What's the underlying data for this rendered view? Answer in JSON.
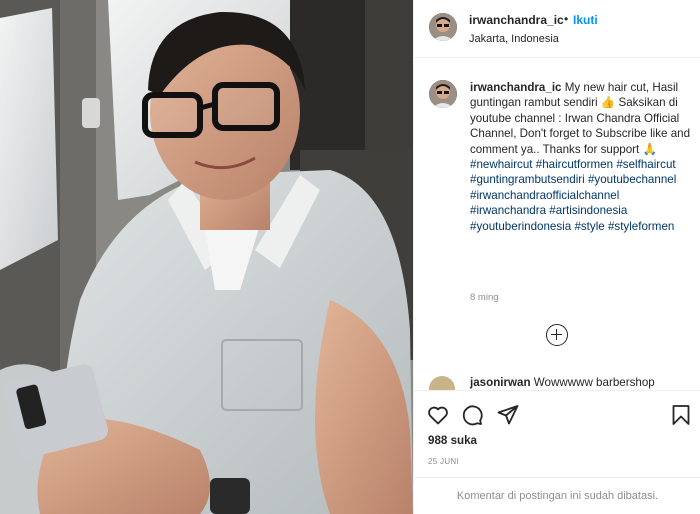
{
  "post": {
    "username": "irwanchandra_ic",
    "dot": "•",
    "follow_label": "Ikuti",
    "location": "Jakarta, Indonesia"
  },
  "caption": {
    "username": "irwanchandra_ic",
    "text_1": "My new hair cut, Hasil guntingan rambut sendiri 👍 Saksikan di youtube channel : Irwan Chandra Official Channel, Don't forget to Subscribe like and comment ya.. Thanks for support 🙏",
    "hashtags": [
      "#newhaircut",
      "#haircutformen",
      "#selfhaircut",
      "#guntingrambutsendiri",
      "#youtubechannel",
      "#irwanchandraofficialchannel",
      "#irwanchandra",
      "#artisindonesia",
      "#youtuberindonesia",
      "#style",
      "#styleformen"
    ],
    "time": "8 ming"
  },
  "comments": [
    {
      "username": "jasonirwan",
      "text": "Wowwwww barbershop"
    }
  ],
  "actions": {
    "like_icon": "heart-icon",
    "comment_icon": "comment-bubble-icon",
    "share_icon": "paper-plane-icon",
    "save_icon": "bookmark-icon",
    "load_more_icon": "plus-circle-icon"
  },
  "likes_text": "988 suka",
  "date": "25 JUNI",
  "comments_disabled": "Komentar di postingan ini sudah dibatasi.",
  "colors": {
    "link_blue": "#0095f6",
    "hashtag": "#00376b",
    "muted": "#8e8e8e",
    "text": "#262626"
  }
}
